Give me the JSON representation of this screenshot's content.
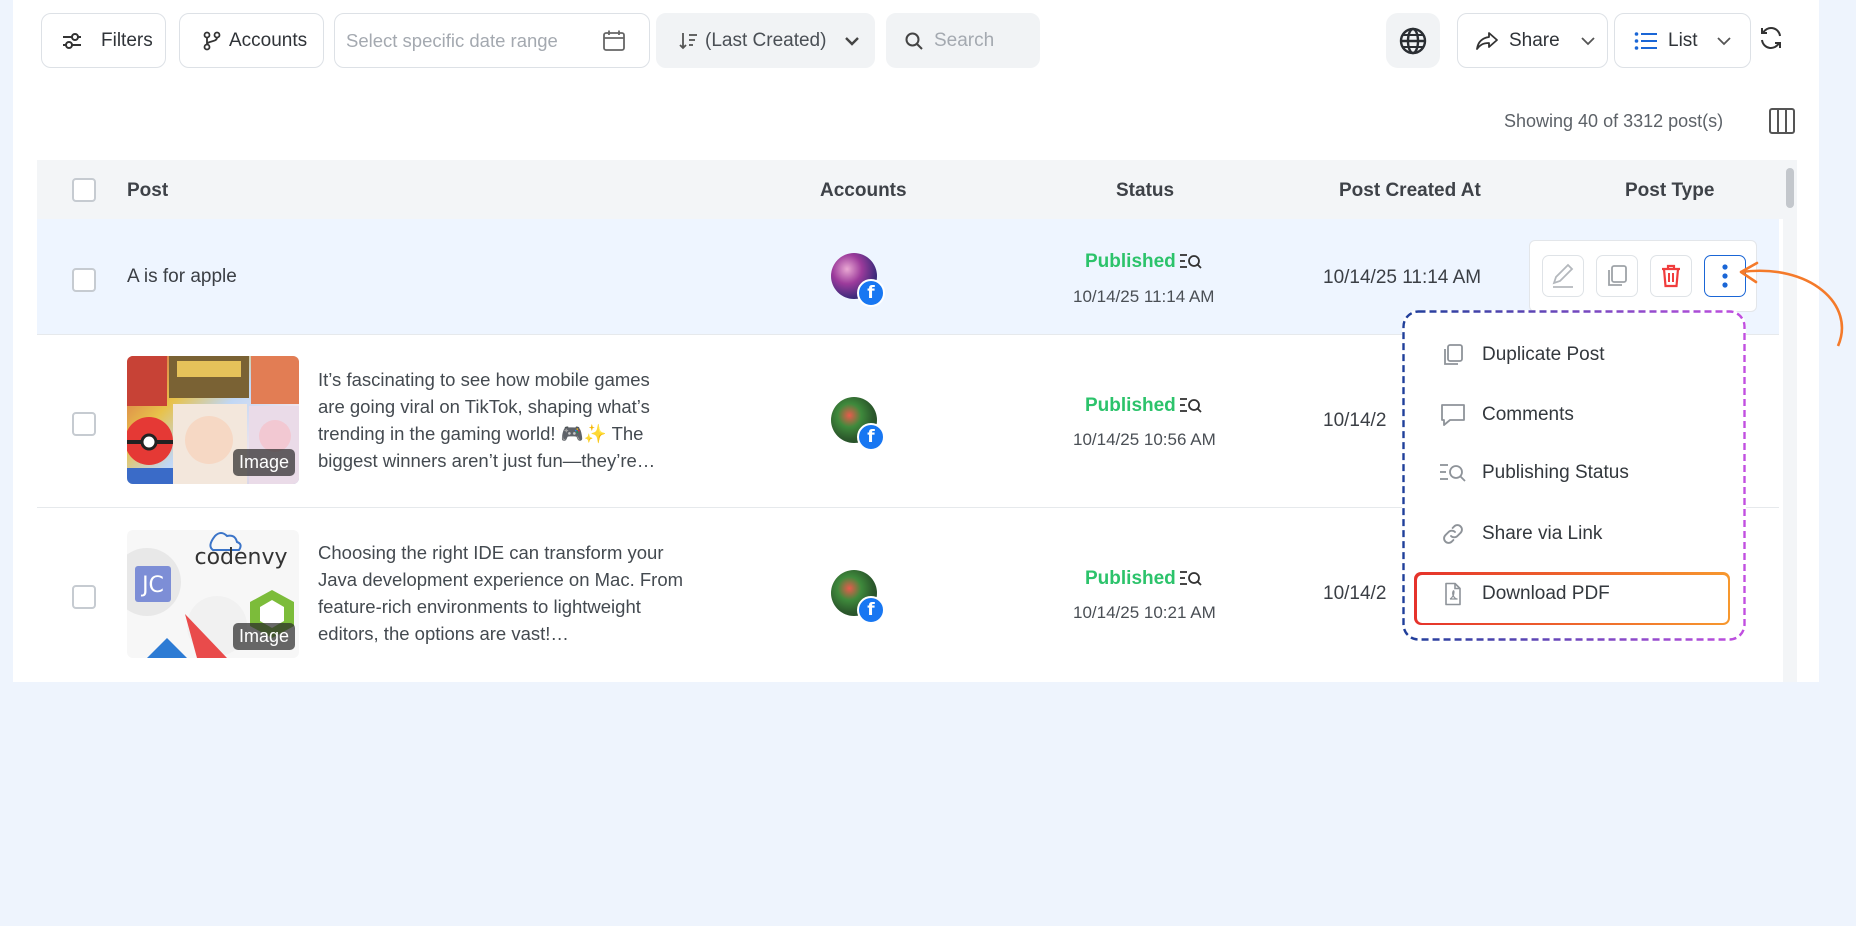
{
  "toolbar": {
    "filters_label": "Filters",
    "accounts_label": "Accounts",
    "date_placeholder": "Select specific date range",
    "sort_label": "(Last Created)",
    "search_placeholder": "Search",
    "share_label": "Share",
    "view_label": "List"
  },
  "summary": "Showing 40 of 3312 post(s)",
  "table": {
    "columns": [
      "Post",
      "Accounts",
      "Status",
      "Post Created At",
      "Post Type"
    ],
    "rows": [
      {
        "post_text": "A is for apple",
        "status": "Published",
        "status_time": "10/14/25 11:14 AM",
        "created_at": "10/14/25 11:14 AM"
      },
      {
        "post_text": "It’s fascinating to see how mobile games are going viral on TikTok, shaping what’s trending in the gaming world! 🎮✨ The biggest winners aren’t just fun—they’re…",
        "thumb_label": "Image",
        "status": "Published",
        "status_time": "10/14/25 10:56 AM",
        "created_at": "10/14/2"
      },
      {
        "post_text": "Choosing the right IDE can transform your Java development experience on Mac. From feature-rich environments to lightweight editors, the options are vast!…",
        "thumb_label": "Image",
        "thumb_brand": "codenvy",
        "status": "Published",
        "status_time": "10/14/25 10:21 AM",
        "created_at": "10/14/2"
      }
    ]
  },
  "menu": {
    "items": [
      {
        "label": "Duplicate Post",
        "icon": "duplicate-icon"
      },
      {
        "label": "Comments",
        "icon": "comment-icon"
      },
      {
        "label": "Publishing Status",
        "icon": "publishing-status-icon"
      },
      {
        "label": "Share via Link",
        "icon": "link-icon"
      },
      {
        "label": "Download PDF",
        "icon": "pdf-icon"
      }
    ]
  },
  "colors": {
    "published": "#2cc36b",
    "facebook": "#1877f2",
    "delete": "#f03d3d",
    "more_accent": "#1a66d6",
    "highlight_row": "#eef5ff",
    "callout_arrow": "#f47a2a"
  }
}
